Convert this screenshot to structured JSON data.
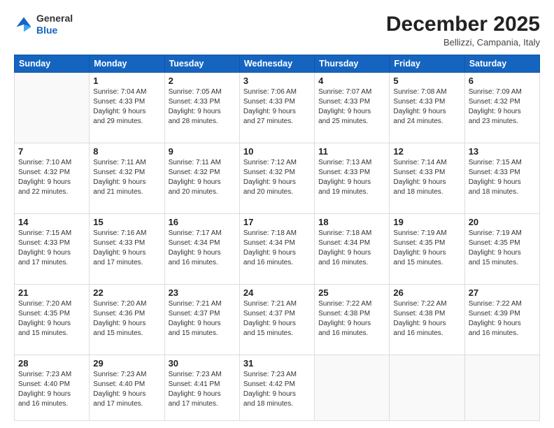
{
  "logo": {
    "general": "General",
    "blue": "Blue"
  },
  "header": {
    "month_year": "December 2025",
    "location": "Bellizzi, Campania, Italy"
  },
  "days_of_week": [
    "Sunday",
    "Monday",
    "Tuesday",
    "Wednesday",
    "Thursday",
    "Friday",
    "Saturday"
  ],
  "weeks": [
    [
      {
        "day": "",
        "sunrise": "",
        "sunset": "",
        "daylight": ""
      },
      {
        "day": "1",
        "sunrise": "Sunrise: 7:04 AM",
        "sunset": "Sunset: 4:33 PM",
        "daylight": "Daylight: 9 hours and 29 minutes."
      },
      {
        "day": "2",
        "sunrise": "Sunrise: 7:05 AM",
        "sunset": "Sunset: 4:33 PM",
        "daylight": "Daylight: 9 hours and 28 minutes."
      },
      {
        "day": "3",
        "sunrise": "Sunrise: 7:06 AM",
        "sunset": "Sunset: 4:33 PM",
        "daylight": "Daylight: 9 hours and 27 minutes."
      },
      {
        "day": "4",
        "sunrise": "Sunrise: 7:07 AM",
        "sunset": "Sunset: 4:33 PM",
        "daylight": "Daylight: 9 hours and 25 minutes."
      },
      {
        "day": "5",
        "sunrise": "Sunrise: 7:08 AM",
        "sunset": "Sunset: 4:33 PM",
        "daylight": "Daylight: 9 hours and 24 minutes."
      },
      {
        "day": "6",
        "sunrise": "Sunrise: 7:09 AM",
        "sunset": "Sunset: 4:32 PM",
        "daylight": "Daylight: 9 hours and 23 minutes."
      }
    ],
    [
      {
        "day": "7",
        "sunrise": "Sunrise: 7:10 AM",
        "sunset": "Sunset: 4:32 PM",
        "daylight": "Daylight: 9 hours and 22 minutes."
      },
      {
        "day": "8",
        "sunrise": "Sunrise: 7:11 AM",
        "sunset": "Sunset: 4:32 PM",
        "daylight": "Daylight: 9 hours and 21 minutes."
      },
      {
        "day": "9",
        "sunrise": "Sunrise: 7:11 AM",
        "sunset": "Sunset: 4:32 PM",
        "daylight": "Daylight: 9 hours and 20 minutes."
      },
      {
        "day": "10",
        "sunrise": "Sunrise: 7:12 AM",
        "sunset": "Sunset: 4:32 PM",
        "daylight": "Daylight: 9 hours and 20 minutes."
      },
      {
        "day": "11",
        "sunrise": "Sunrise: 7:13 AM",
        "sunset": "Sunset: 4:33 PM",
        "daylight": "Daylight: 9 hours and 19 minutes."
      },
      {
        "day": "12",
        "sunrise": "Sunrise: 7:14 AM",
        "sunset": "Sunset: 4:33 PM",
        "daylight": "Daylight: 9 hours and 18 minutes."
      },
      {
        "day": "13",
        "sunrise": "Sunrise: 7:15 AM",
        "sunset": "Sunset: 4:33 PM",
        "daylight": "Daylight: 9 hours and 18 minutes."
      }
    ],
    [
      {
        "day": "14",
        "sunrise": "Sunrise: 7:15 AM",
        "sunset": "Sunset: 4:33 PM",
        "daylight": "Daylight: 9 hours and 17 minutes."
      },
      {
        "day": "15",
        "sunrise": "Sunrise: 7:16 AM",
        "sunset": "Sunset: 4:33 PM",
        "daylight": "Daylight: 9 hours and 17 minutes."
      },
      {
        "day": "16",
        "sunrise": "Sunrise: 7:17 AM",
        "sunset": "Sunset: 4:34 PM",
        "daylight": "Daylight: 9 hours and 16 minutes."
      },
      {
        "day": "17",
        "sunrise": "Sunrise: 7:18 AM",
        "sunset": "Sunset: 4:34 PM",
        "daylight": "Daylight: 9 hours and 16 minutes."
      },
      {
        "day": "18",
        "sunrise": "Sunrise: 7:18 AM",
        "sunset": "Sunset: 4:34 PM",
        "daylight": "Daylight: 9 hours and 16 minutes."
      },
      {
        "day": "19",
        "sunrise": "Sunrise: 7:19 AM",
        "sunset": "Sunset: 4:35 PM",
        "daylight": "Daylight: 9 hours and 15 minutes."
      },
      {
        "day": "20",
        "sunrise": "Sunrise: 7:19 AM",
        "sunset": "Sunset: 4:35 PM",
        "daylight": "Daylight: 9 hours and 15 minutes."
      }
    ],
    [
      {
        "day": "21",
        "sunrise": "Sunrise: 7:20 AM",
        "sunset": "Sunset: 4:35 PM",
        "daylight": "Daylight: 9 hours and 15 minutes."
      },
      {
        "day": "22",
        "sunrise": "Sunrise: 7:20 AM",
        "sunset": "Sunset: 4:36 PM",
        "daylight": "Daylight: 9 hours and 15 minutes."
      },
      {
        "day": "23",
        "sunrise": "Sunrise: 7:21 AM",
        "sunset": "Sunset: 4:37 PM",
        "daylight": "Daylight: 9 hours and 15 minutes."
      },
      {
        "day": "24",
        "sunrise": "Sunrise: 7:21 AM",
        "sunset": "Sunset: 4:37 PM",
        "daylight": "Daylight: 9 hours and 15 minutes."
      },
      {
        "day": "25",
        "sunrise": "Sunrise: 7:22 AM",
        "sunset": "Sunset: 4:38 PM",
        "daylight": "Daylight: 9 hours and 16 minutes."
      },
      {
        "day": "26",
        "sunrise": "Sunrise: 7:22 AM",
        "sunset": "Sunset: 4:38 PM",
        "daylight": "Daylight: 9 hours and 16 minutes."
      },
      {
        "day": "27",
        "sunrise": "Sunrise: 7:22 AM",
        "sunset": "Sunset: 4:39 PM",
        "daylight": "Daylight: 9 hours and 16 minutes."
      }
    ],
    [
      {
        "day": "28",
        "sunrise": "Sunrise: 7:23 AM",
        "sunset": "Sunset: 4:40 PM",
        "daylight": "Daylight: 9 hours and 16 minutes."
      },
      {
        "day": "29",
        "sunrise": "Sunrise: 7:23 AM",
        "sunset": "Sunset: 4:40 PM",
        "daylight": "Daylight: 9 hours and 17 minutes."
      },
      {
        "day": "30",
        "sunrise": "Sunrise: 7:23 AM",
        "sunset": "Sunset: 4:41 PM",
        "daylight": "Daylight: 9 hours and 17 minutes."
      },
      {
        "day": "31",
        "sunrise": "Sunrise: 7:23 AM",
        "sunset": "Sunset: 4:42 PM",
        "daylight": "Daylight: 9 hours and 18 minutes."
      },
      {
        "day": "",
        "sunrise": "",
        "sunset": "",
        "daylight": ""
      },
      {
        "day": "",
        "sunrise": "",
        "sunset": "",
        "daylight": ""
      },
      {
        "day": "",
        "sunrise": "",
        "sunset": "",
        "daylight": ""
      }
    ]
  ]
}
